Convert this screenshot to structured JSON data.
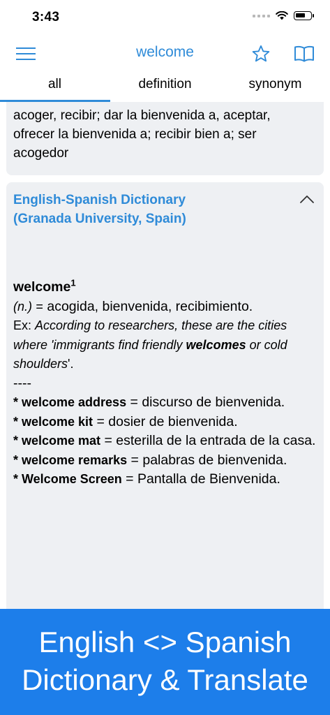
{
  "status": {
    "time": "3:43"
  },
  "nav": {
    "title": "welcome",
    "menu_icon": "hamburger-icon",
    "star_icon": "star-icon",
    "book_icon": "book-icon"
  },
  "tabs": [
    {
      "label": "all",
      "selected": true
    },
    {
      "label": "definition",
      "selected": false
    },
    {
      "label": "synonym",
      "selected": false
    }
  ],
  "card1": {
    "text": "acoger, recibir; dar la bienvenida a, aceptar, ofrecer la bienvenida a; recibir bien a; ser acogedor"
  },
  "card2": {
    "source": "English-Spanish Dictionary (Granada University, Spain)",
    "chevron_icon": "chevron-up-icon",
    "headword": "welcome",
    "sense": "1",
    "pos": "(n.)",
    "equals": "=",
    "translation": "acogida, bienvenida, recibimiento.",
    "ex_prefix": "Ex:",
    "ex_part1": "According to researchers, these are the cities where 'immigrants find friendly",
    "ex_bold": "welcomes",
    "ex_part2": "or cold shoulders",
    "ex_end": "'.",
    "separator": "----",
    "compounds": [
      {
        "term": "* welcome address",
        "eq": "=",
        "translation": "discurso de bienvenida."
      },
      {
        "term": "* welcome kit",
        "eq": "=",
        "translation": "dosier de bienvenida."
      },
      {
        "term": "* welcome mat",
        "eq": "=",
        "translation": "esterilla de la entrada de la casa."
      },
      {
        "term": "* welcome remarks",
        "eq": "=",
        "translation": "palabras de bienvenida."
      },
      {
        "term": "* Welcome Screen",
        "eq": "=",
        "translation": "Pantalla de Bienvenida."
      }
    ]
  },
  "banner": {
    "line1": "English <> Spanish",
    "line2": "Dictionary & Translate"
  },
  "colors": {
    "accent": "#2f8bd8",
    "banner": "#1d7eea",
    "card": "#eef0f3"
  }
}
